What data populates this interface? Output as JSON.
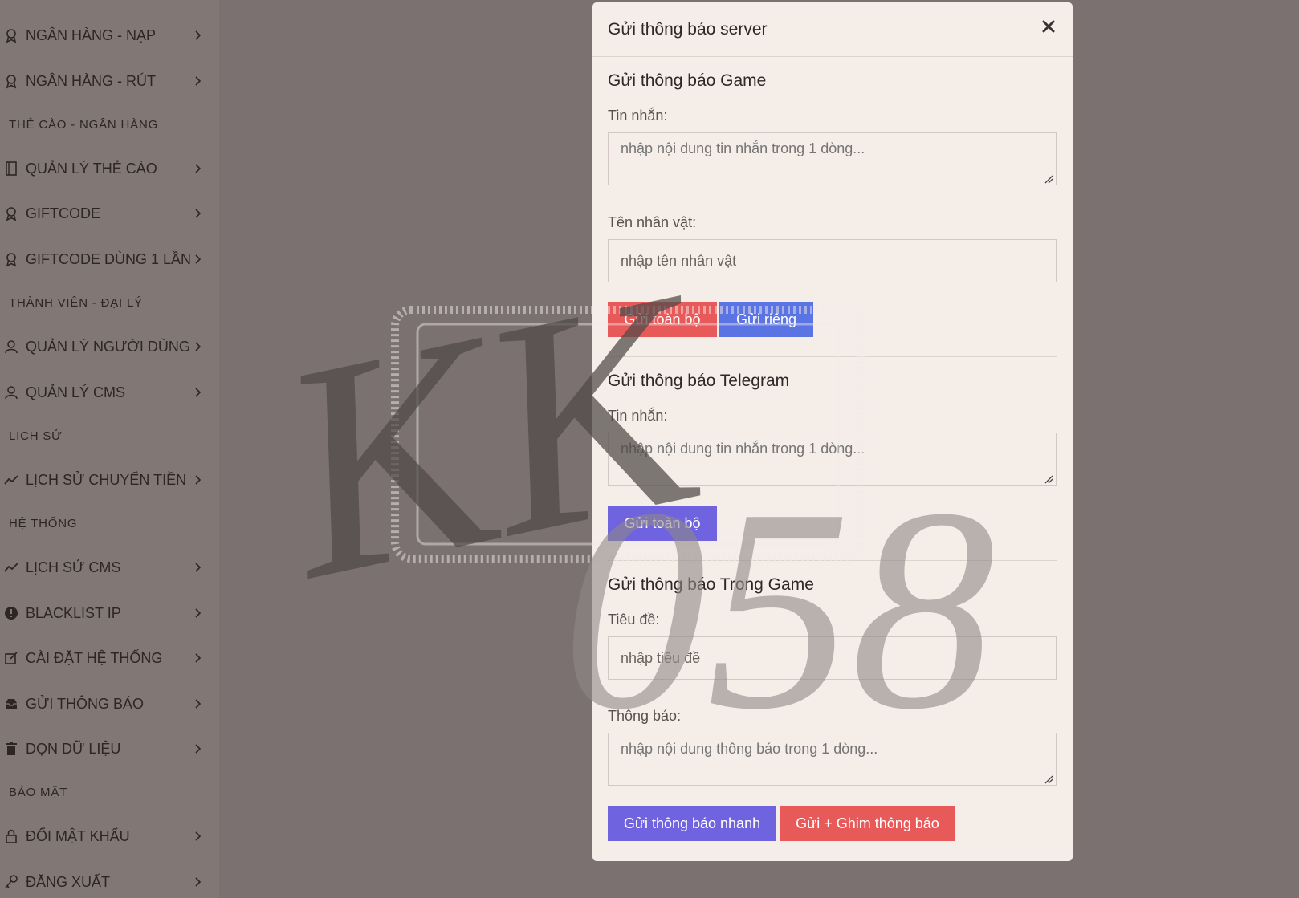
{
  "colors": {
    "overlay_bg": "#7a7170",
    "sidebar_bg": "#817875",
    "modal_bg": "#f4ede8",
    "btn_red": "#e85a5a",
    "btn_blue": "#5b74e4",
    "btn_purple": "#6f63e0"
  },
  "sidebar": {
    "items": [
      {
        "type": "item",
        "label": "NGÂN HÀNG - NẠP",
        "icon": "award-icon"
      },
      {
        "type": "item",
        "label": "NGÂN HÀNG - RÚT",
        "icon": "award-icon"
      },
      {
        "type": "heading",
        "label": "THẺ CÀO - NGÂN HÀNG"
      },
      {
        "type": "item",
        "label": "QUẢN LÝ THẺ CÀO",
        "icon": "book-icon"
      },
      {
        "type": "item",
        "label": "GIFTCODE",
        "icon": "award-icon"
      },
      {
        "type": "item",
        "label": "GIFTCODE DÙNG 1 LẦN",
        "icon": "award-icon"
      },
      {
        "type": "heading",
        "label": "THÀNH VIÊN - ĐẠI LÝ"
      },
      {
        "type": "item",
        "label": "QUẢN LÝ NGƯỜI DÙNG",
        "icon": "user-icon"
      },
      {
        "type": "item",
        "label": "QUẢN LÝ CMS",
        "icon": "user-icon"
      },
      {
        "type": "heading",
        "label": "LỊCH SỬ"
      },
      {
        "type": "item",
        "label": "LỊCH SỬ CHUYỂN TIỀN",
        "icon": "trending-icon"
      },
      {
        "type": "heading",
        "label": "HỆ THỐNG"
      },
      {
        "type": "item",
        "label": "LỊCH SỬ CMS",
        "icon": "trending-icon"
      },
      {
        "type": "item",
        "label": "BLACKLIST IP",
        "icon": "alert-circle-icon"
      },
      {
        "type": "item",
        "label": "CÀI ĐẶT HỆ THỐNG",
        "icon": "edit-icon"
      },
      {
        "type": "item",
        "label": "GỬI THÔNG BÁO",
        "icon": "inbox-icon"
      },
      {
        "type": "item",
        "label": "DỌN DỮ LIỆU",
        "icon": "trash-icon"
      },
      {
        "type": "heading",
        "label": "BẢO MẬT"
      },
      {
        "type": "item",
        "label": "ĐỔI MẬT KHẨU",
        "icon": "lock-icon"
      },
      {
        "type": "item",
        "label": "ĐĂNG XUẤT",
        "icon": "key-icon"
      }
    ]
  },
  "modal": {
    "title": "Gửi thông báo server",
    "close_label": "×",
    "game": {
      "title": "Gửi thông báo Game",
      "message_label": "Tin nhắn:",
      "message_placeholder": "nhập nội dung tin nhắn trong 1 dòng...",
      "character_label": "Tên nhân vật:",
      "character_placeholder": "nhập tên nhân vật",
      "send_all_label": "Gửi toàn bộ",
      "send_private_label": "Gửi riêng"
    },
    "telegram": {
      "title": "Gửi thông báo Telegram",
      "message_label": "Tin nhắn:",
      "message_placeholder": "nhập nội dung tin nhắn trong 1 dòng...",
      "send_all_label": "Gửi toàn bộ"
    },
    "ingame": {
      "title": "Gửi thông báo Trong Game",
      "subject_label": "Tiêu đề:",
      "subject_placeholder": "nhập tiêu đề",
      "notice_label": "Thông báo:",
      "notice_placeholder": "nhập nội dung thông báo trong 1 dòng...",
      "quick_send_label": "Gửi thông báo nhanh",
      "send_pin_label": "Gửi + Ghim thông báo"
    }
  },
  "watermark": {
    "text_kk": "KK",
    "text_058": "058"
  }
}
